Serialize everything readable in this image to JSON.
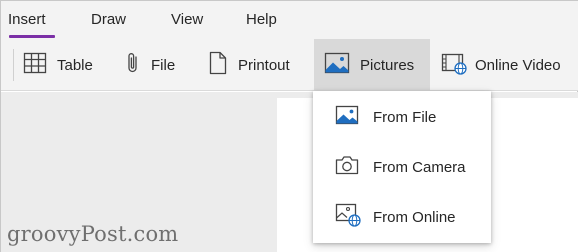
{
  "tabs": [
    {
      "label": "Insert",
      "active": true
    },
    {
      "label": "Draw"
    },
    {
      "label": "View"
    },
    {
      "label": "Help"
    }
  ],
  "ribbon": {
    "table": {
      "label": "Table",
      "icon": "table-icon"
    },
    "file": {
      "label": "File",
      "icon": "paperclip-icon"
    },
    "printout": {
      "label": "Printout",
      "icon": "document-icon"
    },
    "pictures": {
      "label": "Pictures",
      "icon": "picture-icon"
    },
    "online_video": {
      "label": "Online Video",
      "icon": "online-video-icon"
    }
  },
  "dropdown": {
    "items": [
      {
        "label": "From File",
        "icon": "picture-icon"
      },
      {
        "label": "From Camera",
        "icon": "camera-icon"
      },
      {
        "label": "From Online",
        "icon": "online-picture-icon"
      }
    ]
  },
  "watermark": "groovyPost.com",
  "colors": {
    "accent": "#7b2fa6",
    "globe": "#1f6ec0",
    "ribbon_bg": "#f3f3f3",
    "active_button_bg": "#d9d9d9"
  }
}
